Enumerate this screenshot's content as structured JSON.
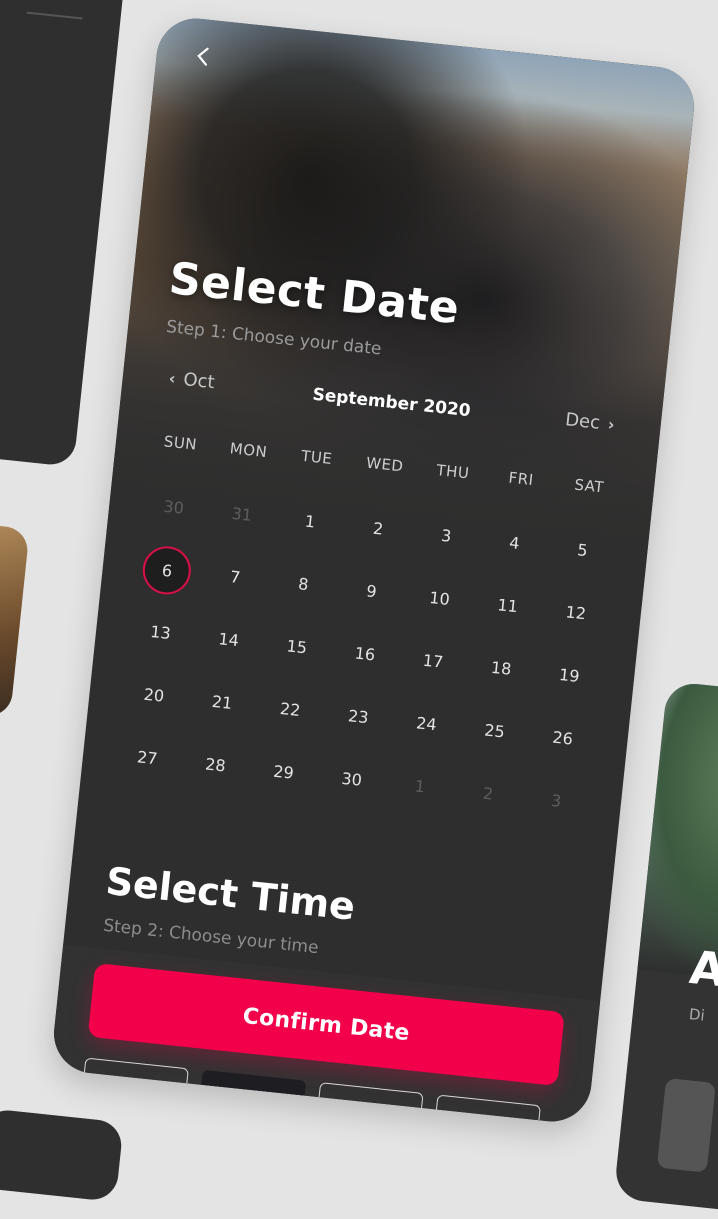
{
  "header": {
    "back_icon": "chevron-left-icon",
    "title": "Select Date",
    "subtitle": "Step 1: Choose your date"
  },
  "month_nav": {
    "prev_label": "Oct",
    "current_label": "September 2020",
    "next_label": "Dec"
  },
  "calendar": {
    "weekdays": [
      "SUN",
      "MON",
      "TUE",
      "WED",
      "THU",
      "FRI",
      "SAT"
    ],
    "weeks": [
      [
        "30",
        "31",
        "1",
        "2",
        "3",
        "4",
        "5"
      ],
      [
        "6",
        "7",
        "8",
        "9",
        "10",
        "11",
        "12"
      ],
      [
        "13",
        "14",
        "15",
        "16",
        "17",
        "18",
        "19"
      ],
      [
        "20",
        "21",
        "22",
        "23",
        "24",
        "25",
        "26"
      ],
      [
        "27",
        "28",
        "29",
        "30",
        "1",
        "2",
        "3"
      ]
    ],
    "selected_day": "6"
  },
  "time_section": {
    "title": "Select Time",
    "subtitle": "Step 2: Choose your time"
  },
  "confirm": {
    "label": "Confirm Date"
  },
  "colors": {
    "accent": "#f3004b",
    "selected_ring": "#d80f47",
    "card_bg": "#2e2e2e",
    "page_bg": "#e4e4e4"
  },
  "right_card": {
    "letter": "A",
    "sub": "Di"
  }
}
